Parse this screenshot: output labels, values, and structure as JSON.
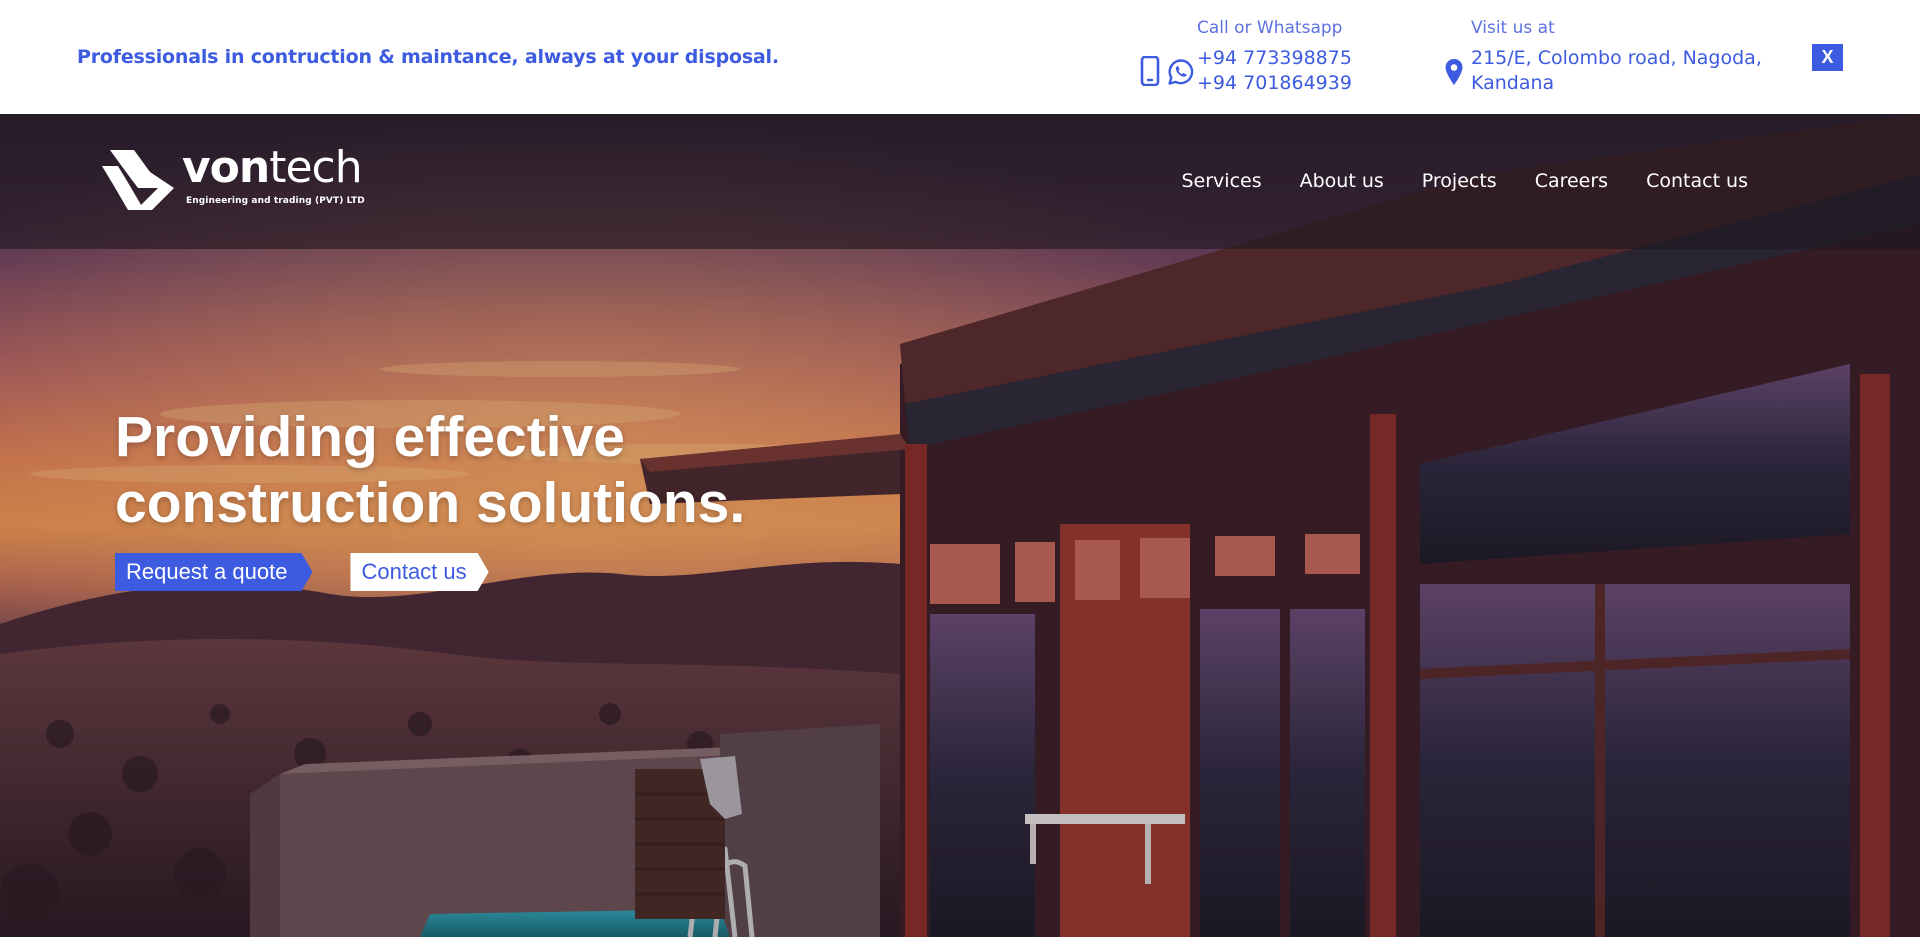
{
  "topbar": {
    "tagline": "Professionals in contruction & maintance, always at your disposal.",
    "call_label": "Call or Whatsapp",
    "phone_1": "+94 773398875",
    "phone_2": "+94 701864939",
    "visit_label": "Visit us at",
    "address": "215/E, Colombo road, Nagoda, Kandana",
    "close_label": "X"
  },
  "brand": {
    "name_bold": "von",
    "name_light": "tech",
    "subtitle": "Engineering and trading (PVT) LTD"
  },
  "nav": {
    "items": [
      "Services",
      "About us",
      "Projects",
      "Careers",
      "Contact us"
    ]
  },
  "hero": {
    "headline_line1": "Providing effective",
    "headline_line2": "construction solutions.",
    "cta_primary": "Request a quote",
    "cta_secondary": "Contact us"
  },
  "colors": {
    "accent": "#3d5be0",
    "white": "#ffffff"
  },
  "icons": [
    "mobile-phone-icon",
    "whatsapp-icon",
    "location-pin-icon"
  ]
}
